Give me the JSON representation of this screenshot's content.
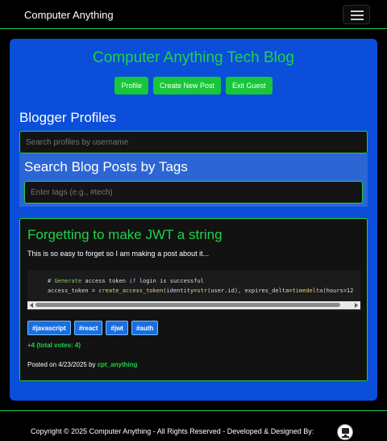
{
  "navbar": {
    "brand": "Computer Anything",
    "menu_icon": "hamburger-icon"
  },
  "main": {
    "title": "Computer Anything Tech Blog",
    "buttons": {
      "profile": "Profile",
      "create": "Create New Post",
      "exit": "Exit Guest"
    },
    "profiles_heading": "Blogger Profiles",
    "profiles_placeholder": "Search profiles by username",
    "tags_heading": "Search Blog Posts by Tags",
    "tags_placeholder": "Enter tags (e.g., #tech)"
  },
  "post": {
    "title": "Forgetting to make JWT a string",
    "excerpt": "This is so easy to forget so I am making a post about it...",
    "code": {
      "l1_hash": "# ",
      "l1_generate": "Generate",
      "l1_mid": " access token ",
      "l1_if": "if",
      "l1_end": " login is successful",
      "l2_a": "access_token = ",
      "l2_fn1": "create_access_token",
      "l2_b": "(identity=",
      "l2_str": "str",
      "l2_c": "(user.id), expires_delta=",
      "l2_fn2": "timedelta",
      "l2_d": "(hours=12"
    },
    "tags": [
      "#javascript",
      "#react",
      "#jwt",
      "#auth"
    ],
    "votes": "+4 (total votes: 4)",
    "posted_prefix": "Posted on 4/23/2025 by ",
    "author": "cpt_anything"
  },
  "footer": {
    "copyright": "Copyright © 2025 Computer Anything - All Rights Reserved - Developed & Designed By:"
  },
  "colors": {
    "accent_green": "#1fd14a",
    "panel_blue": "#0a4ed9",
    "tag_blue": "#1a6fe0"
  }
}
